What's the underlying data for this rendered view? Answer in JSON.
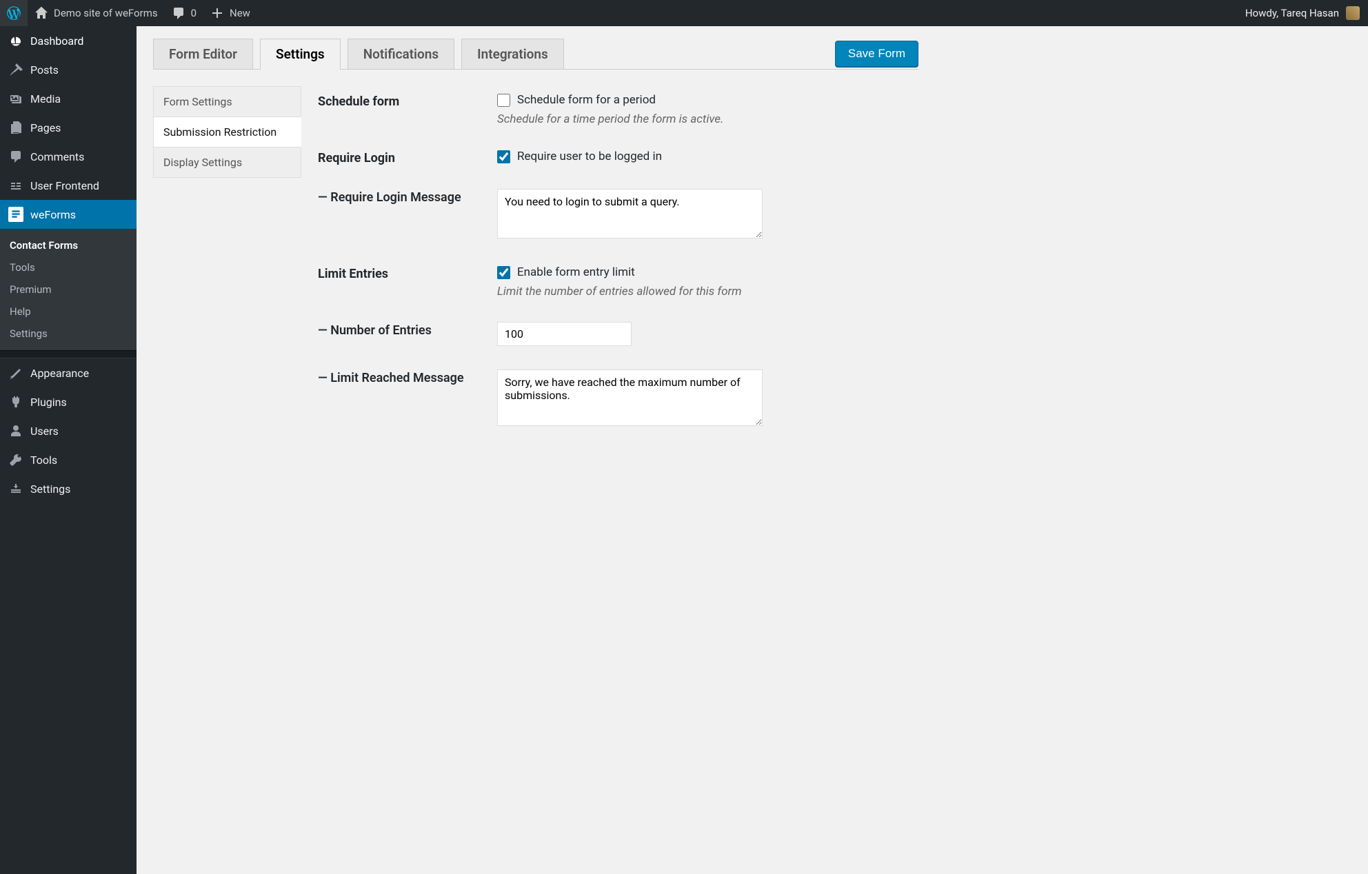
{
  "adminbar": {
    "site_name": "Demo site of weForms",
    "comments_count": "0",
    "new_label": "New",
    "howdy_prefix": "Howdy, ",
    "user_name": "Tareq Hasan"
  },
  "sidebar": {
    "dashboard": "Dashboard",
    "posts": "Posts",
    "media": "Media",
    "pages": "Pages",
    "comments": "Comments",
    "user_frontend": "User Frontend",
    "weforms": "weForms",
    "sub": {
      "contact_forms": "Contact Forms",
      "tools": "Tools",
      "premium": "Premium",
      "help": "Help",
      "settings": "Settings"
    },
    "appearance": "Appearance",
    "plugins": "Plugins",
    "users": "Users",
    "tools": "Tools",
    "settings": "Settings"
  },
  "tabs": {
    "form_editor": "Form Editor",
    "settings": "Settings",
    "notifications": "Notifications",
    "integrations": "Integrations"
  },
  "save_button": "Save Form",
  "subnav": {
    "form_settings": "Form Settings",
    "submission_restriction": "Submission Restriction",
    "display_settings": "Display Settings"
  },
  "fields": {
    "schedule": {
      "label": "Schedule form",
      "checkbox_label": "Schedule form for a period",
      "desc": "Schedule for a time period the form is active.",
      "checked": false
    },
    "require_login": {
      "label": "Require Login",
      "checkbox_label": "Require user to be logged in",
      "checked": true
    },
    "require_login_msg": {
      "label": "— Require Login Message",
      "value": "You need to login to submit a query."
    },
    "limit_entries": {
      "label": "Limit Entries",
      "checkbox_label": "Enable form entry limit",
      "desc": "Limit the number of entries allowed for this form",
      "checked": true
    },
    "num_entries": {
      "label": "— Number of Entries",
      "value": "100"
    },
    "limit_reached_msg": {
      "label": "— Limit Reached Message",
      "value": "Sorry, we have reached the maximum number of submissions."
    }
  }
}
